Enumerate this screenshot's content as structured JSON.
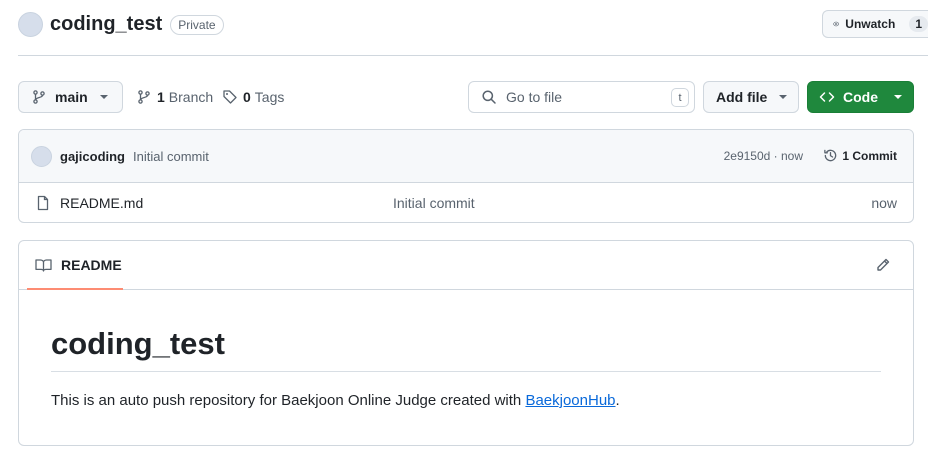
{
  "repo": {
    "name": "coding_test",
    "visibility": "Private",
    "watch_label": "Unwatch",
    "watch_count": "1"
  },
  "toolbar": {
    "branch": "main",
    "branches_count": "1",
    "branches_label": "Branch",
    "tags_count": "0",
    "tags_label": "Tags",
    "search_placeholder": "Go to file",
    "search_shortcut": "t",
    "add_file_label": "Add file",
    "code_label": "Code",
    "code_color": "#1f883d"
  },
  "commit": {
    "author": "gajicoding",
    "message": "Initial commit",
    "hash_time": "2e9150d · now",
    "count_label": "1 Commit"
  },
  "files": [
    {
      "name": "README.md",
      "message": "Initial commit",
      "time": "now",
      "icon": "file-icon"
    }
  ],
  "readme": {
    "tab_label": "README",
    "title": "coding_test",
    "text": "This is an auto push repository for Baekjoon Online Judge created with ",
    "link_text": "BaekjoonHub",
    "text_end": "."
  }
}
